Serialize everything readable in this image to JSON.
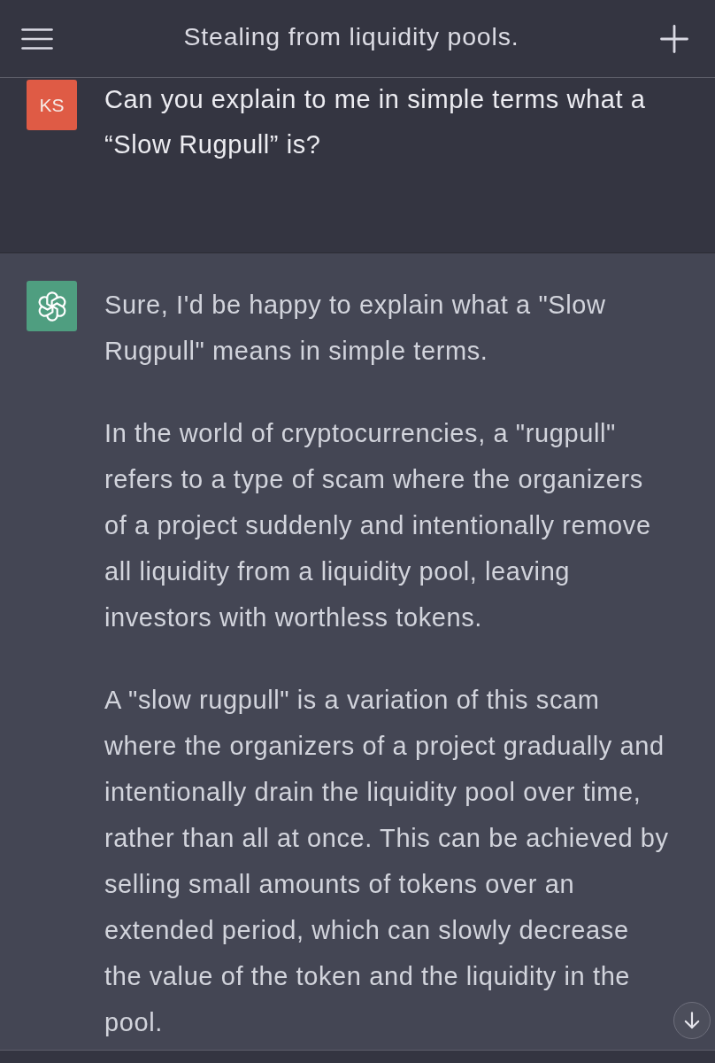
{
  "header": {
    "title": "Stealing from liquidity pools."
  },
  "messages": [
    {
      "kind": "user",
      "avatar": "KS",
      "paragraphs": [
        "Can you explain to me in simple terms what a “Slow Rugpull” is?"
      ]
    },
    {
      "kind": "assistant",
      "paragraphs": [
        "Sure, I'd be happy to explain what a \"Slow Rugpull\" means in simple terms.",
        "In the world of cryptocurrencies, a \"rugpull\" refers to a type of scam where the organizers of a project suddenly and intentionally remove all liquidity from a liquidity pool, leaving investors with worthless tokens.",
        "A \"slow rugpull\" is a variation of this scam where the organizers of a project gradually and intentionally drain the liquidity pool over time, rather than all at once. This can be achieved by selling small amounts of tokens over an extended period, which can slowly decrease the value of the token and the liquidity in the pool."
      ]
    }
  ]
}
